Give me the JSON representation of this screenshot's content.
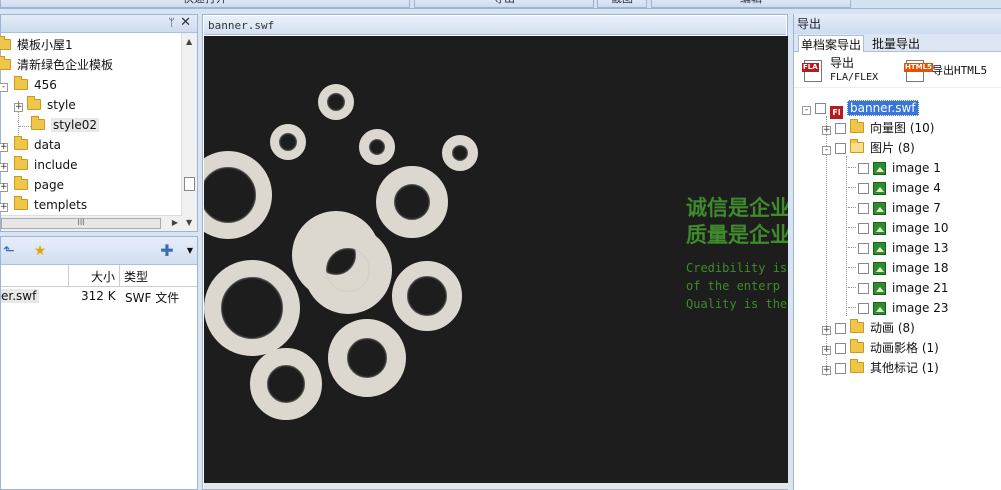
{
  "toolbar": {
    "buttons": [
      "快速打开",
      "导出",
      "截图",
      "编辑"
    ]
  },
  "left_tree": {
    "pin_icon": "pin-icon",
    "close_icon": "close-icon",
    "items": [
      {
        "label": "模板小屋1",
        "expanded": true
      },
      {
        "label": "清新绿色企业模板",
        "expanded": true
      },
      {
        "label": "456",
        "expanded": true
      },
      {
        "label": "style",
        "expanded": false
      },
      {
        "label": "style02",
        "expanded": false
      },
      {
        "label": "data",
        "expanded": false
      },
      {
        "label": "include",
        "expanded": false
      },
      {
        "label": "page",
        "expanded": false
      },
      {
        "label": "templets",
        "expanded": false
      }
    ],
    "hscroll_label": "III"
  },
  "file_list": {
    "columns": {
      "size": "大小",
      "type": "类型"
    },
    "rows": [
      {
        "name": "er.swf",
        "size": "312 K",
        "type": "SWF 文件"
      }
    ]
  },
  "preview": {
    "tab_title": "banner.swf",
    "slogan_cn": [
      "诚信是企业",
      "质量是企业"
    ],
    "slogan_en": [
      "Credibility is t",
      "of the enterp",
      "Quality is the"
    ],
    "slogan_color": "#3f8a2c",
    "background_color": "#1d1d1d"
  },
  "export_panel": {
    "title": "导出",
    "tabs": {
      "single": "单档案导出",
      "batch": "批量导出"
    },
    "fla_button": {
      "line1": "导出",
      "line2": "FLA/FLEX",
      "badge": "FLA"
    },
    "html5_button": {
      "label": "导出HTML5",
      "badge": "HTML5"
    },
    "root": "banner.swf",
    "nodes": [
      {
        "label": "向量图 (10)",
        "icon": "folder-icon",
        "expanded": false
      },
      {
        "label": "图片 (8)",
        "icon": "open-folder-icon",
        "expanded": true
      },
      {
        "label": "动画 (8)",
        "icon": "folder-icon",
        "expanded": false
      },
      {
        "label": "动画影格 (1)",
        "icon": "folder-icon",
        "expanded": false
      },
      {
        "label": "其他标记 (1)",
        "icon": "folder-icon",
        "expanded": false
      }
    ],
    "images": [
      "image 1",
      "image 4",
      "image 7",
      "image 10",
      "image 13",
      "image 18",
      "image 21",
      "image 23"
    ]
  }
}
